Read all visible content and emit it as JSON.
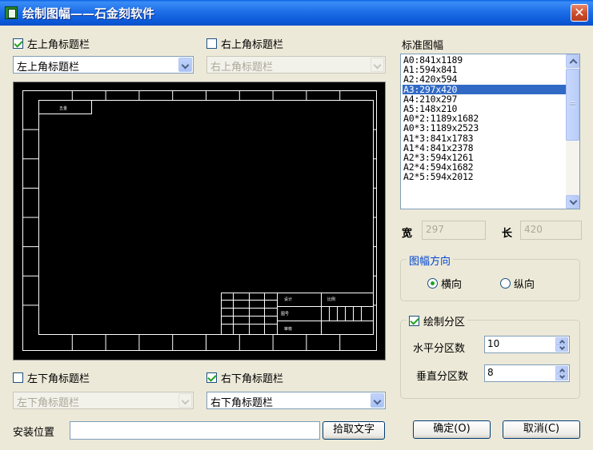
{
  "window": {
    "title": "绘制图幅——石金刻软件",
    "close_glyph": "✕"
  },
  "corners": {
    "top_left": {
      "checkbox_label": "左上角标题栏",
      "checked": true,
      "combo_value": "左上角标题栏",
      "enabled": true
    },
    "top_right": {
      "checkbox_label": "右上角标题栏",
      "checked": false,
      "combo_value": "右上角标题栏",
      "enabled": false
    },
    "bottom_left": {
      "checkbox_label": "左下角标题栏",
      "checked": false,
      "combo_value": "左下角标题栏",
      "enabled": false
    },
    "bottom_right": {
      "checkbox_label": "右下角标题栏",
      "checked": true,
      "combo_value": "右下角标题栏",
      "enabled": true
    }
  },
  "preview": {
    "tag_text": "五金",
    "block_labels": {
      "designer": "设计",
      "scale": "比例",
      "title": "图号",
      "approve": "审核"
    }
  },
  "standard_sizes": {
    "label": "标准图幅",
    "items": [
      "A0:841x1189",
      "A1:594x841",
      "A2:420x594",
      "A3:297x420",
      "A4:210x297",
      "A5:148x210",
      "A0*2:1189x1682",
      "A0*3:1189x2523",
      "A1*3:841x1783",
      "A1*4:841x2378",
      "A2*3:594x1261",
      "A2*4:594x1682",
      "A2*5:594x2012"
    ],
    "selected_index": 3
  },
  "dimensions": {
    "width_label": "宽",
    "width_value": "297",
    "length_label": "长",
    "length_value": "420"
  },
  "orientation": {
    "group_title": "图幅方向",
    "landscape_label": "横向",
    "portrait_label": "纵向",
    "selected": "landscape"
  },
  "zones": {
    "checkbox_label": "绘制分区",
    "checked": true,
    "horizontal_label": "水平分区数",
    "horizontal_value": "10",
    "vertical_label": "垂直分区数",
    "vertical_value": "8"
  },
  "install": {
    "label": "安装位置",
    "value": "",
    "pick_button": "拾取文字"
  },
  "actions": {
    "ok_button": "确定(O)",
    "cancel_button": "取消(C)"
  },
  "colors": {
    "title_bar": "#0a5fe4",
    "dialog_bg": "#ece9d8",
    "selection": "#316ac5",
    "check_green": "#21a121",
    "group_title": "#0046d5"
  }
}
